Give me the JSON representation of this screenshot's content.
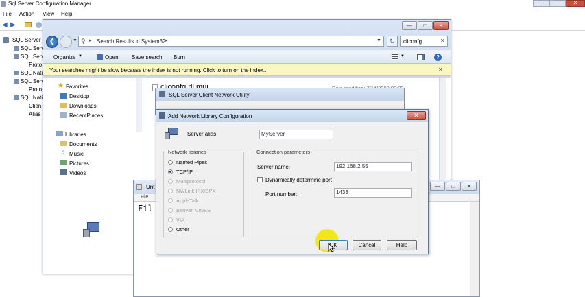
{
  "mgr": {
    "title": "Sql Server Configuration Manager",
    "menu": [
      "File",
      "Action",
      "View",
      "Help"
    ],
    "tree": [
      "SQL Server C",
      "SQL Serv",
      "SQL Serv",
      "Proto",
      "SQL Nati",
      "SQL Serv",
      "Proto",
      "SQL Nati",
      "Clien",
      "Alias"
    ]
  },
  "explorer": {
    "breadcrumb": "Search Results in System32",
    "search_value": "cliconfg",
    "toolbar": {
      "organize": "Organize",
      "open": "Open",
      "save_search": "Save search",
      "burn": "Burn"
    },
    "info_bar": "Your searches might be slow because the index is not running.  Click to turn on the index...",
    "nav": {
      "favorites": "Favorites",
      "desktop": "Desktop",
      "downloads": "Downloads",
      "recent": "RecentPlaces",
      "libraries": "Libraries",
      "documents": "Documents",
      "music": "Music",
      "pictures": "Pictures",
      "videos": "Videos"
    },
    "result_name": "cliconfg.rll.mui",
    "result_date": "Date modified: 7/14/2009 09:23"
  },
  "notepad": {
    "title": "Unt",
    "menu_file": "File",
    "body": "Fil"
  },
  "client_util": {
    "title": "SQL Server Client Network Utility"
  },
  "dialog": {
    "title": "Add Network Library Configuration",
    "server_alias_label": "Server alias:",
    "server_alias_value": "MyServer",
    "libraries_legend": "Network libraries",
    "libraries": [
      {
        "label": "Named Pipes",
        "selected": false,
        "enabled": true
      },
      {
        "label": "TCP/IP",
        "selected": true,
        "enabled": true
      },
      {
        "label": "Multiprotocol",
        "selected": false,
        "enabled": false
      },
      {
        "label": "NWLink IPX/SPX",
        "selected": false,
        "enabled": false
      },
      {
        "label": "AppleTalk",
        "selected": false,
        "enabled": false
      },
      {
        "label": "Banyan VINES",
        "selected": false,
        "enabled": false
      },
      {
        "label": "VIA",
        "selected": false,
        "enabled": false
      },
      {
        "label": "Other",
        "selected": false,
        "enabled": true
      }
    ],
    "params_legend": "Connection parameters",
    "server_name_label": "Server name:",
    "server_name_value": "192.168.2.55",
    "dynamic_port_label": "Dynamically determine port",
    "port_label": "Port number:",
    "port_value": "1433",
    "ok": "OK",
    "cancel": "Cancel",
    "help": "Help"
  },
  "colors": {
    "highlight": "#f2e600",
    "dialog_bg": "#f0f0f0",
    "title_bg": "#c9dcf1",
    "info_bar": "#fbf7c4"
  }
}
